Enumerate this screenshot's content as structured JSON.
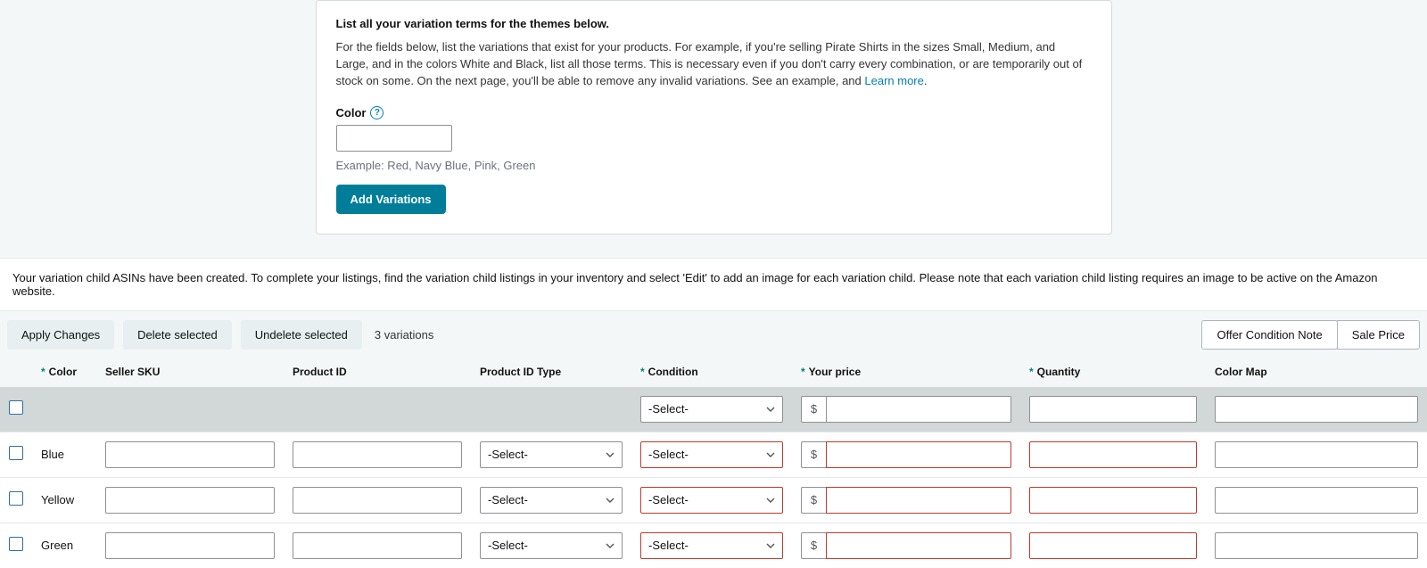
{
  "card": {
    "title": "List all your variation terms for the themes below.",
    "desc_1": "For the fields below, list the variations that exist for your products. For example, if you're selling Pirate Shirts in the sizes Small, Medium, and Large, and in the colors White and Black, list all those terms. This is necessary even if you don't carry every combination, or are temporarily out of stock on some. On the next page, you'll be able to remove any invalid variations. See an example, and ",
    "learn_more": "Learn more",
    "color_label": "Color",
    "help_glyph": "?",
    "example_text": "Example: Red, Navy Blue, Pink, Green",
    "add_variations": "Add Variations"
  },
  "notice": "Your variation child ASINs have been created. To complete your listings, find the variation child listings in your inventory and select 'Edit' to add an image for each variation child. Please note that each variation child listing requires an image to be active on the Amazon website.",
  "toolbar": {
    "apply": "Apply Changes",
    "delete": "Delete selected",
    "undelete": "Undelete selected",
    "count": "3 variations",
    "offer_note": "Offer Condition Note",
    "sale_price": "Sale Price"
  },
  "headers": {
    "req": "*",
    "color": "Color",
    "sku": "Seller SKU",
    "pid": "Product ID",
    "pidtype": "Product ID Type",
    "condition": "Condition",
    "price": "Your price",
    "qty": "Quantity",
    "map": "Color Map"
  },
  "select_placeholder": "-Select-",
  "currency": "$",
  "rows": [
    {
      "color": "Blue"
    },
    {
      "color": "Yellow"
    },
    {
      "color": "Green"
    }
  ]
}
